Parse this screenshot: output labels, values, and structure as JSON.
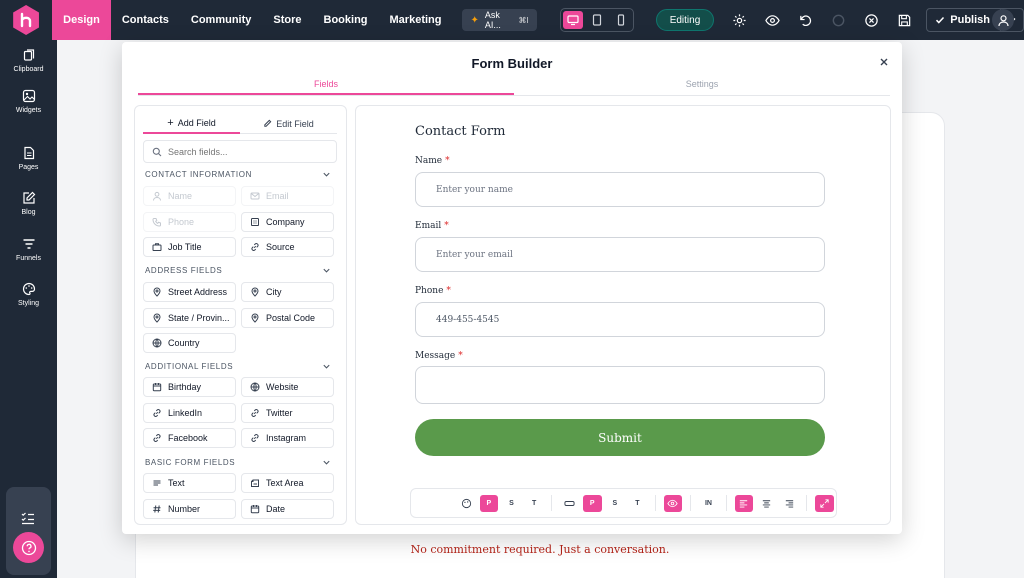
{
  "topbar": {
    "nav": [
      {
        "label": "Design",
        "active": true
      },
      {
        "label": "Contacts"
      },
      {
        "label": "Community"
      },
      {
        "label": "Store"
      },
      {
        "label": "Booking"
      },
      {
        "label": "Marketing"
      }
    ],
    "ask_ai": "Ask AI...",
    "ask_ai_shortcut": "⌘I",
    "mode": "Editing",
    "publish": "Publish"
  },
  "rail": {
    "items": [
      {
        "label": "Clipboard",
        "icon": "clipboard-icon"
      },
      {
        "label": "Widgets",
        "icon": "widgets-icon"
      },
      {
        "label": "Pages",
        "icon": "pages-icon"
      },
      {
        "label": "Blog",
        "icon": "blog-icon"
      },
      {
        "label": "Funnels",
        "icon": "funnels-icon"
      },
      {
        "label": "Styling",
        "icon": "styling-icon"
      }
    ]
  },
  "canvas": {
    "footer_text": "No commitment required. Just a conversation."
  },
  "modal": {
    "title": "Form Builder",
    "tabs": [
      "Fields",
      "Settings"
    ],
    "panel": {
      "tabs": [
        "Add Field",
        "Edit Field"
      ],
      "search_placeholder": "Search fields...",
      "sections": [
        {
          "title": "CONTACT INFORMATION",
          "fields": [
            {
              "label": "Name",
              "disabled": true,
              "icon": "user-icon"
            },
            {
              "label": "Email",
              "disabled": true,
              "icon": "mail-icon"
            },
            {
              "label": "Phone",
              "disabled": true,
              "icon": "phone-icon"
            },
            {
              "label": "Company",
              "icon": "building-icon"
            },
            {
              "label": "Job Title",
              "icon": "briefcase-icon"
            },
            {
              "label": "Source",
              "icon": "link-icon"
            }
          ]
        },
        {
          "title": "ADDRESS FIELDS",
          "fields": [
            {
              "label": "Street Address",
              "icon": "pin-icon"
            },
            {
              "label": "City",
              "icon": "pin-icon"
            },
            {
              "label": "State / Provin...",
              "icon": "pin-icon"
            },
            {
              "label": "Postal Code",
              "icon": "pin-icon"
            },
            {
              "label": "Country",
              "icon": "globe-icon"
            }
          ]
        },
        {
          "title": "ADDITIONAL FIELDS",
          "fields": [
            {
              "label": "Birthday",
              "icon": "calendar-icon"
            },
            {
              "label": "Website",
              "icon": "globe-icon"
            },
            {
              "label": "LinkedIn",
              "icon": "link-icon"
            },
            {
              "label": "Twitter",
              "icon": "link-icon"
            },
            {
              "label": "Facebook",
              "icon": "link-icon"
            },
            {
              "label": "Instagram",
              "icon": "link-icon"
            }
          ]
        },
        {
          "title": "BASIC FORM FIELDS",
          "fields": [
            {
              "label": "Text",
              "icon": "text-icon"
            },
            {
              "label": "Text Area",
              "icon": "textarea-icon"
            },
            {
              "label": "Number",
              "icon": "hash-icon"
            },
            {
              "label": "Date",
              "icon": "calendar-icon"
            }
          ]
        }
      ]
    },
    "form": {
      "title": "Contact Form",
      "fields": [
        {
          "label": "Name",
          "placeholder": "Enter your name",
          "value": ""
        },
        {
          "label": "Email",
          "placeholder": "Enter your email",
          "value": ""
        },
        {
          "label": "Phone",
          "placeholder": "",
          "value": "449-455-4545"
        },
        {
          "label": "Message",
          "placeholder": "",
          "value": ""
        }
      ],
      "submit": "Submit"
    },
    "toolbar": {
      "p1": "P",
      "s1": "S",
      "t1": "T",
      "p2": "P",
      "s2": "S",
      "t2": "T",
      "in": "IN"
    }
  },
  "colors": {
    "accent": "#ec4899",
    "dark": "#1f2937",
    "submit": "#5a9a4b"
  }
}
